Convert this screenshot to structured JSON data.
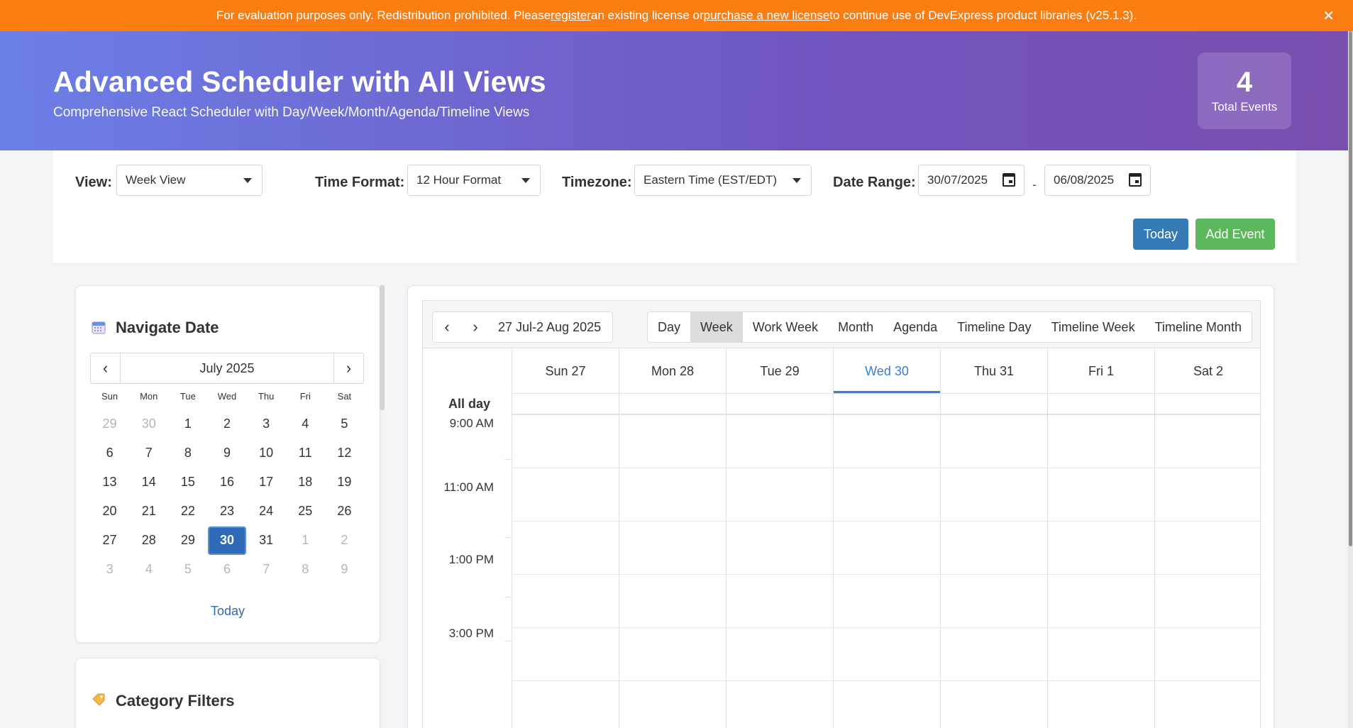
{
  "banner": {
    "text_before": "For evaluation purposes only. Redistribution prohibited. Please ",
    "link_register": "register",
    "text_middle": " an existing license or ",
    "link_purchase": "purchase a new license",
    "text_after": " to continue use of DevExpress product libraries (v25.1.3).",
    "close": "✕"
  },
  "header": {
    "title": "Advanced Scheduler with All Views",
    "subtitle": "Comprehensive React Scheduler with Day/Week/Month/Agenda/Timeline Views",
    "stat_value": "4",
    "stat_label": "Total Events"
  },
  "toolbar": {
    "view_label": "View:",
    "view_value": "Week View",
    "time_format_label": "Time Format:",
    "time_format_value": "12 Hour Format",
    "timezone_label": "Timezone:",
    "timezone_value": "Eastern Time (EST/EDT)",
    "date_range_label": "Date Range:",
    "date_from": "30/07/2025",
    "date_sep": "-",
    "date_to": "06/08/2025",
    "today_button": "Today",
    "add_event_button": "Add Event"
  },
  "navigator": {
    "title": "Navigate Date",
    "month_caption": "July 2025",
    "prev": "‹",
    "next": "›",
    "days_of_week": [
      "Sun",
      "Mon",
      "Tue",
      "Wed",
      "Thu",
      "Fri",
      "Sat"
    ],
    "weeks": [
      [
        "29",
        "30",
        "1",
        "2",
        "3",
        "4",
        "5"
      ],
      [
        "6",
        "7",
        "8",
        "9",
        "10",
        "11",
        "12"
      ],
      [
        "13",
        "14",
        "15",
        "16",
        "17",
        "18",
        "19"
      ],
      [
        "20",
        "21",
        "22",
        "23",
        "24",
        "25",
        "26"
      ],
      [
        "27",
        "28",
        "29",
        "30",
        "31",
        "1",
        "2"
      ],
      [
        "3",
        "4",
        "5",
        "6",
        "7",
        "8",
        "9"
      ]
    ],
    "selected_day": "30",
    "today_link": "Today"
  },
  "categories": {
    "title": "Category Filters"
  },
  "scheduler": {
    "prev": "‹",
    "next": "›",
    "date_range": "27 Jul-2 Aug 2025",
    "views": [
      "Day",
      "Week",
      "Work Week",
      "Month",
      "Agenda",
      "Timeline Day",
      "Timeline Week",
      "Timeline Month"
    ],
    "active_view": "Week",
    "columns": [
      "Sun 27",
      "Mon 28",
      "Tue 29",
      "Wed 30",
      "Thu 31",
      "Fri 1",
      "Sat 2"
    ],
    "today_column": "Wed 30",
    "all_day_label": "All day",
    "time_labels": [
      "9:00 AM",
      "11:00 AM",
      "1:00 PM",
      "3:00 PM"
    ]
  }
}
